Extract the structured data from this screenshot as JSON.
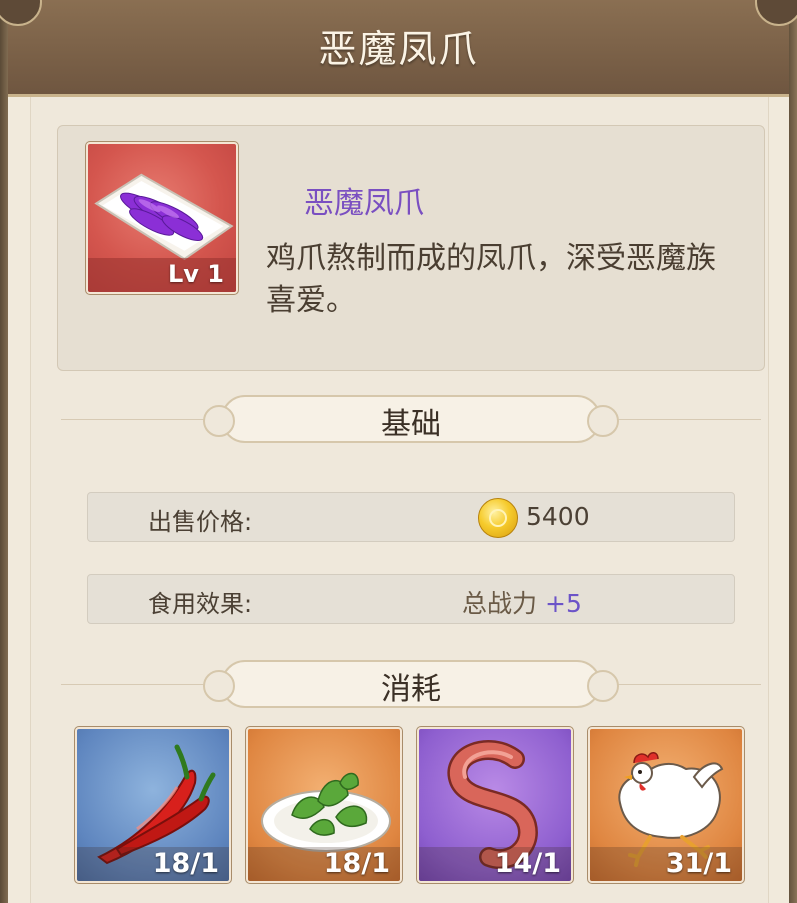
{
  "header": {
    "title": "恶魔凤爪"
  },
  "item": {
    "name": "恶魔凤爪",
    "level": "Lv 1",
    "description": "鸡爪熬制而成的凤爪，深受恶魔族喜爱。",
    "icon": "purple-chicken-feet-plate"
  },
  "basic": {
    "heading": "基础",
    "sell_label": "出售价格:",
    "sell_value": "5400",
    "effect_label": "食用效果:",
    "effect_stat": "总战力",
    "effect_value": "+5"
  },
  "consume": {
    "heading": "消耗",
    "materials": [
      {
        "icon": "red-chili-pepper",
        "count": "18/1",
        "bg": "#5f86bf"
      },
      {
        "icon": "herb-plate",
        "count": "18/1",
        "bg": "#df8641"
      },
      {
        "icon": "earthworm",
        "count": "14/1",
        "bg": "#8e5fcf"
      },
      {
        "icon": "white-chicken",
        "count": "31/1",
        "bg": "#df8641"
      }
    ]
  },
  "colors": {
    "name_accent": "#7a4fc1",
    "stat_plus": "#6c54c8",
    "header_bg": "#7a6048"
  }
}
